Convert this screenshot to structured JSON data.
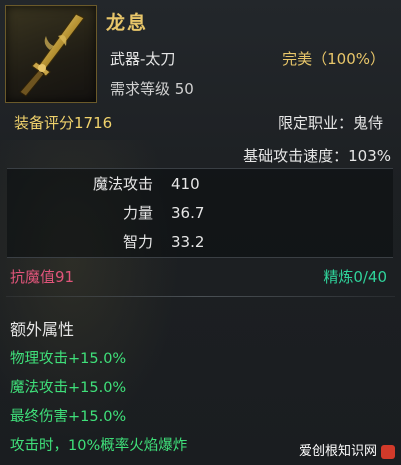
{
  "item": {
    "name": "龙息",
    "type": "武器-太刀",
    "level_req": "需求等级 50",
    "quality": "完美（100%）",
    "score": "装备评分1716",
    "job": "限定职业：鬼侍",
    "attack_speed": "基础攻击速度：103%"
  },
  "stats": [
    {
      "label": "魔法攻击",
      "value": "410"
    },
    {
      "label": "力量",
      "value": "36.7"
    },
    {
      "label": "智力",
      "value": "33.2"
    }
  ],
  "resist": "抗魔值91",
  "refine": "精炼0/40",
  "extra": {
    "title": "额外属性",
    "items": [
      "物理攻击+15.0%",
      "魔法攻击+15.0%",
      "最终伤害+15.0%",
      "攻击时，10%概率火焰爆炸"
    ]
  },
  "watermark": "爱创根知识网",
  "colors": {
    "gold": "#e8c66a",
    "resist": "#e0557a",
    "refine": "#2fd29a",
    "extra": "#3fe07a"
  },
  "icon": "katana-weapon-icon"
}
